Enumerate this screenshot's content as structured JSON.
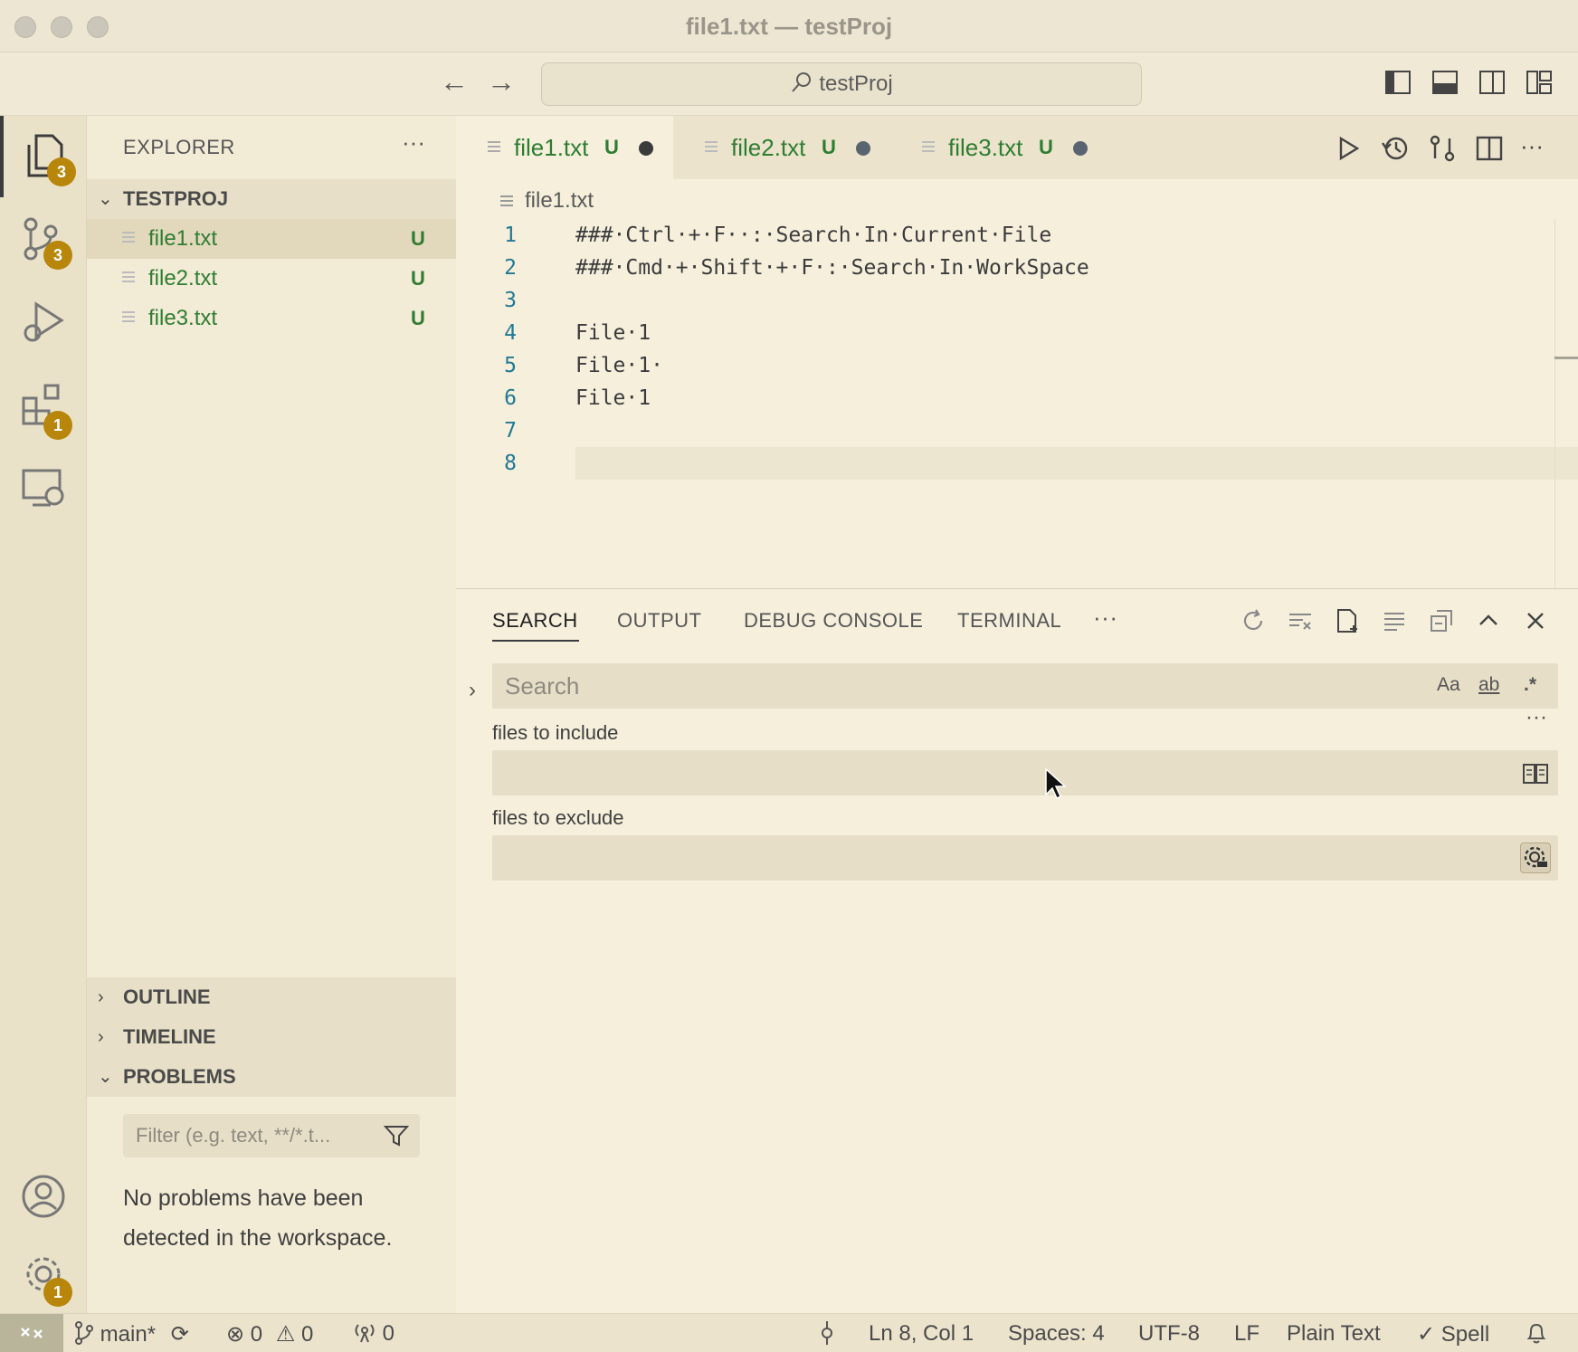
{
  "window": {
    "title": "file1.txt — testProj"
  },
  "command_center": {
    "text": "testProj"
  },
  "activity_bar": {
    "explorer_badge": "3",
    "scm_badge": "3",
    "extensions_badge": "1",
    "settings_badge": "1"
  },
  "sidebar": {
    "title": "EXPLORER",
    "more": "···",
    "project": "TESTPROJ",
    "files": [
      {
        "name": "file1.txt",
        "status": "U"
      },
      {
        "name": "file2.txt",
        "status": "U"
      },
      {
        "name": "file3.txt",
        "status": "U"
      }
    ],
    "sections": {
      "outline": "OUTLINE",
      "timeline": "TIMELINE",
      "problems": "PROBLEMS"
    },
    "problems_filter_placeholder": "Filter (e.g. text, **/*.t...",
    "problems_message": "No problems have been detected in the workspace."
  },
  "tabs": [
    {
      "name": "file1.txt",
      "status": "U"
    },
    {
      "name": "file2.txt",
      "status": "U"
    },
    {
      "name": "file3.txt",
      "status": "U"
    }
  ],
  "editor": {
    "breadcrumb": "file1.txt",
    "lines": [
      {
        "n": "1",
        "text": "###·Ctrl·+·F··:·Search·In·Current·File"
      },
      {
        "n": "2",
        "text": "###·Cmd·+·Shift·+·F·:·Search·In·WorkSpace"
      },
      {
        "n": "3",
        "text": ""
      },
      {
        "n": "4",
        "text": "File·1"
      },
      {
        "n": "5",
        "text": "File·1·"
      },
      {
        "n": "6",
        "text": "File·1"
      },
      {
        "n": "7",
        "text": ""
      },
      {
        "n": "8",
        "text": ""
      }
    ]
  },
  "panel": {
    "tabs": {
      "search": "SEARCH",
      "output": "OUTPUT",
      "debug_console": "DEBUG CONSOLE",
      "terminal": "TERMINAL",
      "more": "···"
    },
    "search_placeholder": "Search",
    "opt_case": "Aa",
    "opt_word": "ab",
    "opt_regex": ".*",
    "files_to_include_label": "files to include",
    "files_to_exclude_label": "files to exclude",
    "more": "···"
  },
  "status_bar": {
    "branch": "main*",
    "errors": "0",
    "warnings": "0",
    "ports": "0",
    "position": "Ln 8, Col 1",
    "spaces": "Spaces: 4",
    "encoding": "UTF-8",
    "eol": "LF",
    "language": "Plain Text",
    "spell": "Spell"
  }
}
